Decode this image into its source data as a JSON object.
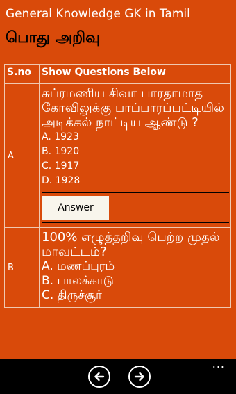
{
  "app_title": "General Knowledge GK in Tamil",
  "page_header": "பொது அறிவு",
  "table": {
    "headers": {
      "sno": "S.no",
      "questions": "Show Questions Below"
    },
    "rows": [
      {
        "sno": "A",
        "question": "சுப்ரமணிய சிவா பாரதாமாத கோவிலுக்கு பாப்பாரப்பட்டியில் அடிக்கல் நாட்டிய ஆண்டு ?",
        "options": [
          "A. 1923",
          "B. 1920",
          "C. 1917",
          "D. 1928"
        ],
        "answer_label": "Answer"
      },
      {
        "sno": "B",
        "question": "100% எழுத்தறிவு பெற்ற முதல் மாவட்டம்?",
        "options": [
          "A. மணப்புரம்",
          "B. பாலக்காடு",
          "C. திருச்சூர்"
        ]
      }
    ]
  },
  "appbar": {
    "back_icon": "arrow-left-icon",
    "forward_icon": "arrow-right-icon",
    "more_label": "..."
  }
}
